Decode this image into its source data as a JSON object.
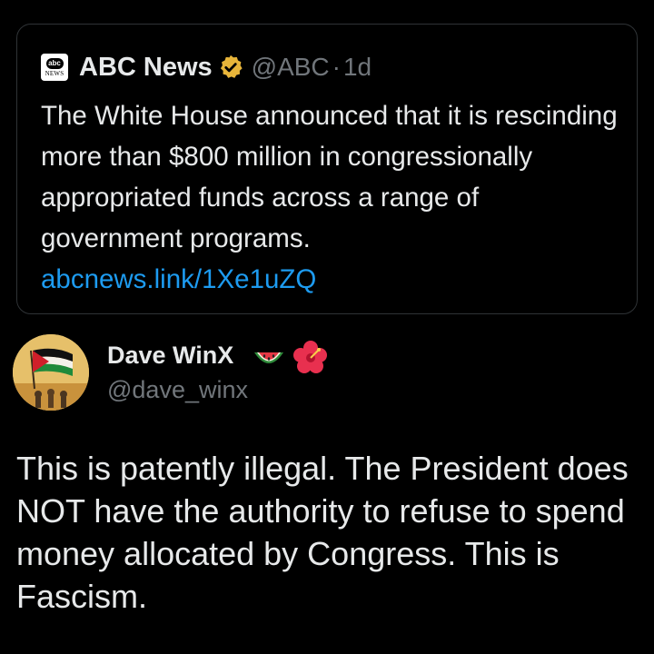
{
  "quoted_post": {
    "logo_top": "abc",
    "logo_bottom": "NEWS",
    "author_name": "ABC News",
    "handle": "@ABC",
    "separator": "·",
    "time": "1d",
    "text": "The White House announced that it is rescinding more than $800 million in congressionally appropriated funds across a range of government programs.",
    "link": "abcnews.link/1Xe1uZQ",
    "verified_icon": "gold-verified-badge"
  },
  "reply_post": {
    "author_name": "Dave WinX",
    "handle": "@dave_winx",
    "name_emojis": [
      "watermelon",
      "hibiscus"
    ],
    "avatar": "palestinian-flag-illustration",
    "text": "This is patently illegal. The President does NOT have the authority to refuse to spend money allocated by Congress. This is Fascism."
  },
  "colors": {
    "background": "#000000",
    "text": "#e7e9ea",
    "muted": "#71767b",
    "link": "#1d9bf0",
    "border": "#2f3336",
    "verified_gold": "#e8b53a"
  }
}
